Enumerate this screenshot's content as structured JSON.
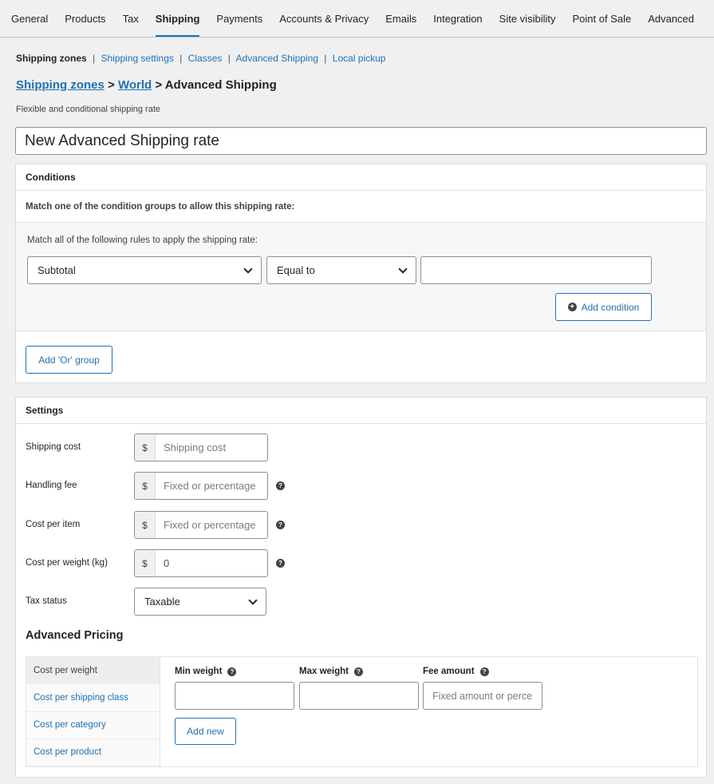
{
  "tabs": [
    {
      "label": "General",
      "active": false
    },
    {
      "label": "Products",
      "active": false
    },
    {
      "label": "Tax",
      "active": false
    },
    {
      "label": "Shipping",
      "active": true
    },
    {
      "label": "Payments",
      "active": false
    },
    {
      "label": "Accounts & Privacy",
      "active": false
    },
    {
      "label": "Emails",
      "active": false
    },
    {
      "label": "Integration",
      "active": false
    },
    {
      "label": "Site visibility",
      "active": false
    },
    {
      "label": "Point of Sale",
      "active": false
    },
    {
      "label": "Advanced",
      "active": false
    }
  ],
  "subnav": {
    "current": "Shipping zones",
    "links": [
      "Shipping settings",
      "Classes",
      "Advanced Shipping",
      "Local pickup"
    ]
  },
  "breadcrumb": {
    "part1": "Shipping zones",
    "sep1": " > ",
    "part2": "World",
    "sep2": " > ",
    "current": "Advanced Shipping"
  },
  "description": "Flexible and conditional shipping rate",
  "rate_title": "New Advanced Shipping rate",
  "conditions": {
    "heading": "Conditions",
    "match_text": "Match one of the condition groups to allow this shipping rate:",
    "group_text": "Match all of the following rules to apply the shipping rate:",
    "condition_select": "Subtotal",
    "operator_select": "Equal to",
    "value": "",
    "add_condition": "Add condition",
    "add_or_group": "Add 'Or' group"
  },
  "settings": {
    "heading": "Settings",
    "currency_symbol": "$",
    "shipping_cost_label": "Shipping cost",
    "shipping_cost_placeholder": "Shipping cost",
    "handling_fee_label": "Handling fee",
    "handling_fee_placeholder": "Fixed or percentage",
    "cost_per_item_label": "Cost per item",
    "cost_per_item_placeholder": "Fixed or percentage",
    "cost_per_weight_label": "Cost per weight (kg)",
    "cost_per_weight_value": "0",
    "tax_status_label": "Tax status",
    "tax_status_value": "Taxable",
    "help_glyph": "?"
  },
  "advanced_pricing": {
    "heading": "Advanced Pricing",
    "tabs": [
      {
        "label": "Cost per weight",
        "active": true
      },
      {
        "label": "Cost per shipping class",
        "active": false
      },
      {
        "label": "Cost per category",
        "active": false
      },
      {
        "label": "Cost per product",
        "active": false
      }
    ],
    "min_weight": "Min weight",
    "max_weight": "Max weight",
    "fee_amount": "Fee amount",
    "fee_placeholder": "Fixed amount or perce",
    "add_new": "Add new"
  }
}
